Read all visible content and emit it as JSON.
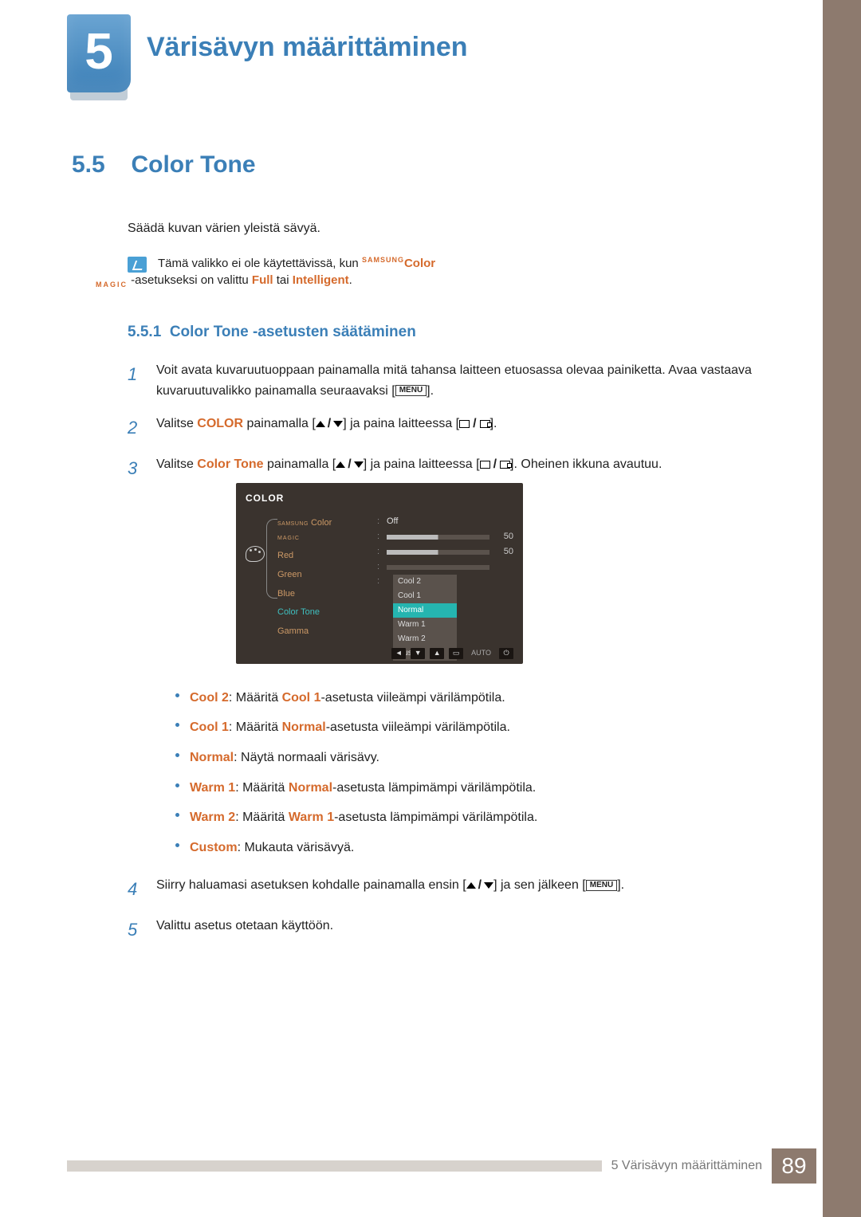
{
  "chapter": {
    "number": "5",
    "title": "Värisävyn määrittäminen"
  },
  "section": {
    "number": "5.5",
    "title": "Color Tone"
  },
  "intro": "Säädä kuvan värien yleistä sävyä.",
  "note": {
    "pre": "Tämä valikko ei ole käytettävissä, kun ",
    "magic_top": "SAMSUNG",
    "magic_bot": "MAGIC",
    "mid": "Color",
    "mid2": "-asetukseksi on valittu ",
    "full": "Full",
    "or": " tai ",
    "intelligent": "Intelligent",
    "end": "."
  },
  "subsection": {
    "number": "5.5.1",
    "title": "Color Tone -asetusten säätäminen"
  },
  "steps": {
    "s1a": "Voit avata kuvaruutuoppaan painamalla mitä tahansa laitteen etuosassa olevaa painiketta. Avaa vastaava kuvaruutuvalikko painamalla seuraavaksi [",
    "menu": "MENU",
    "s1b": "].",
    "s2a": "Valitse ",
    "s2color": "COLOR",
    "s2b": " painamalla [",
    "s2c": "] ja paina laitteessa [",
    "s2d": "].",
    "s3a": "Valitse ",
    "s3ct": "Color Tone",
    "s3b": " painamalla [",
    "s3c": "] ja paina laitteessa [",
    "s3d": "]. Oheinen ikkuna avautuu.",
    "s4a": "Siirry haluamasi asetuksen kohdalle painamalla ensin [",
    "s4b": "] ja sen jälkeen [",
    "s4c": "].",
    "s5": "Valittu asetus otetaan käyttöön."
  },
  "osd": {
    "title": "COLOR",
    "menu": [
      "Color",
      "Red",
      "Green",
      "Blue",
      "Color Tone",
      "Gamma"
    ],
    "magic_top": "SAMSUNG",
    "magic_bot": "MAGIC",
    "off": "Off",
    "val_red": "50",
    "val_green": "50",
    "popup": [
      "Cool 2",
      "Cool 1",
      "Normal",
      "Warm 1",
      "Warm 2",
      "Custom"
    ],
    "auto": "AUTO"
  },
  "bullets": [
    {
      "term": "Cool 2",
      "sep": ": Määritä ",
      "ref": "Cool 1",
      "rest": "-asetusta viileämpi värilämpötila."
    },
    {
      "term": "Cool 1",
      "sep": ": Määritä ",
      "ref": "Normal",
      "rest": "-asetusta viileämpi värilämpötila."
    },
    {
      "term": "Normal",
      "sep": ": Näytä normaali värisävy.",
      "ref": "",
      "rest": ""
    },
    {
      "term": "Warm 1",
      "sep": ": Määritä ",
      "ref": "Normal",
      "rest": "-asetusta lämpimämpi värilämpötila."
    },
    {
      "term": "Warm 2",
      "sep": ": Määritä ",
      "ref": "Warm 1",
      "rest": "-asetusta lämpimämpi värilämpötila."
    },
    {
      "term": "Custom",
      "sep": ": Mukauta värisävyä.",
      "ref": "",
      "rest": ""
    }
  ],
  "footer": {
    "text": "5 Värisävyn määrittäminen",
    "page": "89"
  }
}
